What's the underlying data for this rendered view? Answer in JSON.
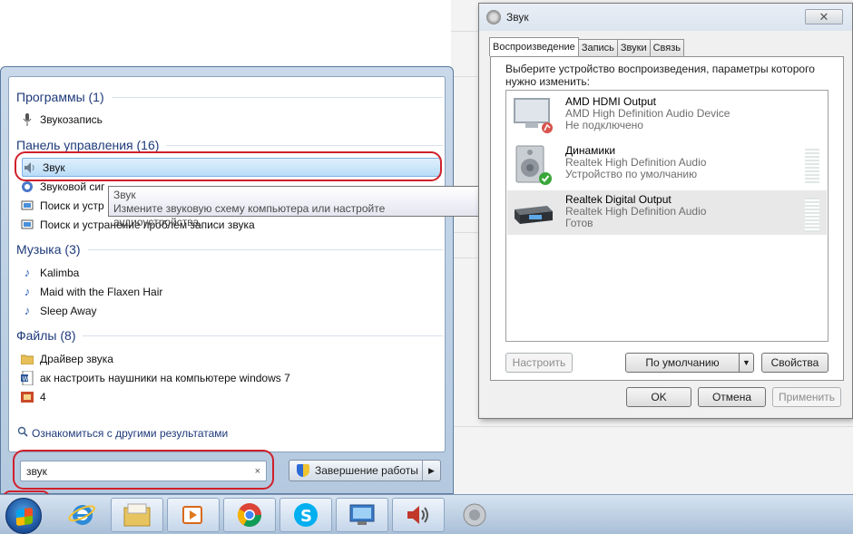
{
  "start_menu": {
    "groups": {
      "programs": {
        "title": "Программы (1)",
        "items": [
          {
            "label": "Звукозапись",
            "icon": "microphone-icon"
          }
        ]
      },
      "control_panel": {
        "title": "Панель управления (16)",
        "items": [
          {
            "label": "Звук",
            "icon": "speaker-icon"
          },
          {
            "label": "Звуковой сиг",
            "icon": "sound-scheme-icon"
          },
          {
            "label": "Поиск и устр",
            "icon": "troubleshoot-icon"
          },
          {
            "label": "Поиск и устранение проблем записи звука",
            "icon": "troubleshoot-icon"
          }
        ]
      },
      "music": {
        "title": "Музыка (3)",
        "items": [
          {
            "label": "Kalimba",
            "icon": "music-note-icon"
          },
          {
            "label": "Maid with the Flaxen Hair",
            "icon": "music-note-icon"
          },
          {
            "label": "Sleep Away",
            "icon": "music-note-icon"
          }
        ]
      },
      "files": {
        "title": "Файлы (8)",
        "items": [
          {
            "label": "Драйвер звука",
            "icon": "folder-icon"
          },
          {
            "label": "ак настроить наушники на компьютере windows 7",
            "icon": "word-doc-icon"
          },
          {
            "label": "4",
            "icon": "image-file-icon"
          }
        ]
      }
    },
    "tooltip": {
      "title": "Звук",
      "text": "Измените звуковую схему компьютера или настройте аудиоустройства."
    },
    "more_results": "Ознакомиться с другими результатами",
    "search": {
      "value": "звук",
      "clear": "×"
    },
    "shutdown_label": "Завершение работы"
  },
  "dialog": {
    "title": "Звук",
    "close": "✕",
    "tabs": [
      "Воспроизведение",
      "Запись",
      "Звуки",
      "Связь"
    ],
    "instruction": "Выберите устройство воспроизведения, параметры которого нужно изменить:",
    "devices": [
      {
        "name": "AMD HDMI Output",
        "desc": "AMD High Definition Audio Device",
        "status": "Не подключено"
      },
      {
        "name": "Динамики",
        "desc": "Realtek High Definition Audio",
        "status": "Устройство по умолчанию"
      },
      {
        "name": "Realtek Digital Output",
        "desc": "Realtek High Definition Audio",
        "status": "Готов"
      }
    ],
    "buttons": {
      "configure": "Настроить",
      "set_default": "По умолчанию",
      "properties": "Свойства",
      "ok": "OK",
      "cancel": "Отмена",
      "apply": "Применить"
    }
  }
}
